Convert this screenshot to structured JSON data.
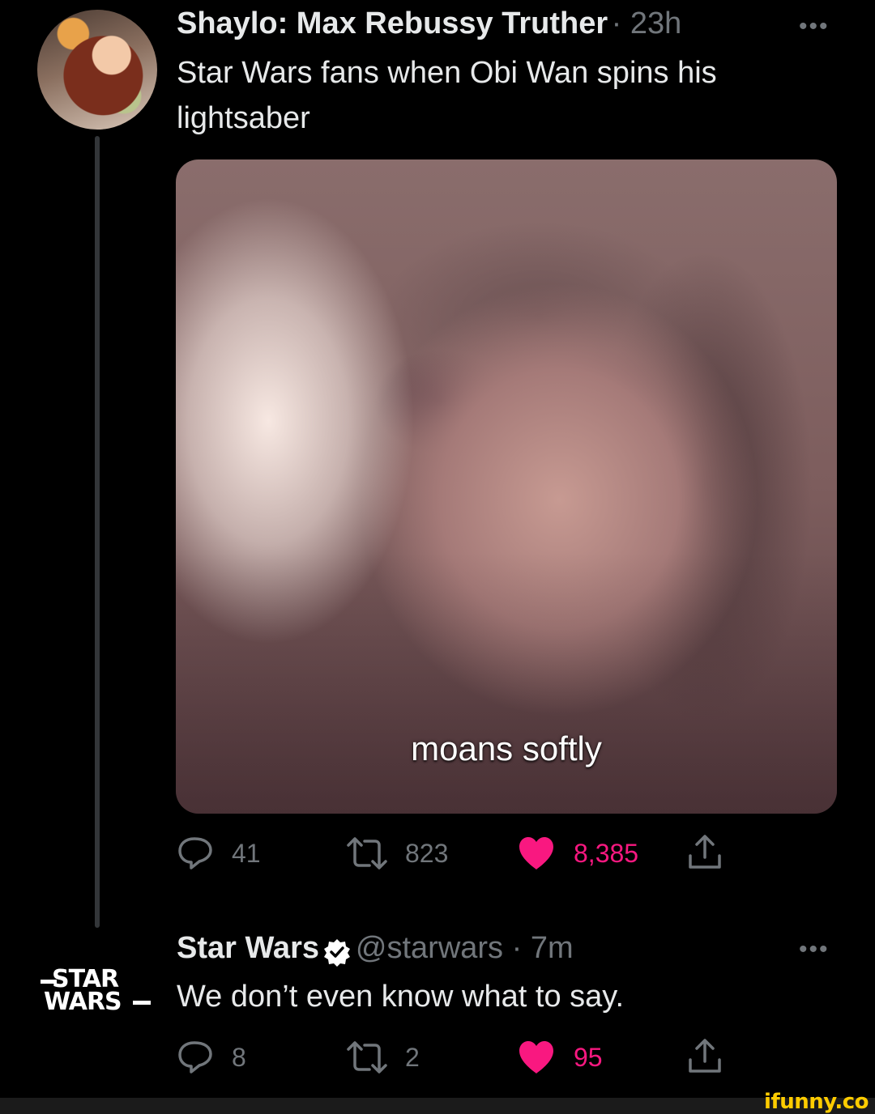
{
  "tweet1": {
    "display_name": "Shaylo: Max Rebussy Truther",
    "time": "· 23h",
    "more_icon": "more-dots-icon",
    "text_line1": "Star Wars fans when Obi Wan spins his",
    "text_line2": "lightsaber",
    "media_caption": "moans softly",
    "actions": {
      "replies": "41",
      "retweets": "823",
      "likes": "8,385"
    }
  },
  "tweet2": {
    "display_name": "Star Wars",
    "handle_time": "@starwars · 7m",
    "logo_line1": "STAR",
    "logo_line2": "WARS",
    "text": "We don’t even know what to say.",
    "actions": {
      "replies": "8",
      "retweets": "2",
      "likes": "95"
    }
  },
  "watermark": "ifunny.co",
  "colors": {
    "background": "#000000",
    "text_primary": "#e7e9ea",
    "text_secondary": "#71767b",
    "like_pink": "#f91880",
    "verified_fill": "#ffffff",
    "watermark": "#ffcc00"
  }
}
